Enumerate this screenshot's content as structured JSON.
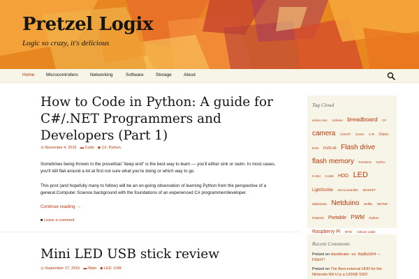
{
  "site": {
    "title": "Pretzel Logix",
    "description": "Logic so crazy, it's delicious"
  },
  "colors": {
    "accent": "#bc360a",
    "nav_bg": "#f7f5e7",
    "header_base": "#e8861f"
  },
  "nav": {
    "items": [
      {
        "label": "Home",
        "active": true
      },
      {
        "label": "Microcontrollers"
      },
      {
        "label": "Networking"
      },
      {
        "label": "Software"
      },
      {
        "label": "Storage"
      },
      {
        "label": "About"
      }
    ],
    "search_icon": "search-icon"
  },
  "posts": [
    {
      "title": "How to Code in Python: A guide for C#/.NET Programmers and Developers (Part 1)",
      "date": "November 4, 2015",
      "category": "Code",
      "tags": "C#, Python",
      "paragraphs": [
        "Sometimes being thrown in the proverbial \"deep end\" is the best way to learn — you'll either sink or swim. In most cases, you'll still flail around a lot at first not sure what you're doing or which way to go.",
        "This post (and hopefully many to follow) will be an on-going observation of learning Python from the perspective of a general Computer Science background with the foundations of an experienced C# programmer/developer."
      ],
      "continue": "Continue reading →",
      "comment": "Leave a comment"
    },
    {
      "title": "Mini LED USB stick review",
      "date": "September 17, 2015",
      "category": "Main",
      "tags": "LED, USB"
    }
  ],
  "sidebar": {
    "tag_cloud_title": "Tag Cloud",
    "tags": [
      {
        "label": "action cam",
        "size": 4.5
      },
      {
        "label": "Arduino",
        "size": 4.5
      },
      {
        "label": "breadboard",
        "size": 8.5
      },
      {
        "label": "C#",
        "size": 4.5
      },
      {
        "label": "camera",
        "size": 10
      },
      {
        "label": "CCENT",
        "size": 4.5
      },
      {
        "label": "CCNA",
        "size": 4.5
      },
      {
        "label": "C-R",
        "size": 4.5
      },
      {
        "label": "Cisco",
        "size": 5.5
      },
      {
        "label": "DVD",
        "size": 4.5
      },
      {
        "label": "DVD+R",
        "size": 5.5
      },
      {
        "label": "Flash drive",
        "size": 10
      },
      {
        "label": "flash memory",
        "size": 10
      },
      {
        "label": "FreeNAS",
        "size": 4.5
      },
      {
        "label": "GoPro",
        "size": 4.5
      },
      {
        "label": "H.264",
        "size": 4.5
      },
      {
        "label": "H.265",
        "size": 4.5
      },
      {
        "label": "HDD",
        "size": 7
      },
      {
        "label": "LED",
        "size": 11
      },
      {
        "label": "LightScribe",
        "size": 6
      },
      {
        "label": "microcontroller",
        "size": 4.5
      },
      {
        "label": "MOSFET",
        "size": 4.5
      },
      {
        "label": "Multimeter",
        "size": 4.5
      },
      {
        "label": "Netduino",
        "size": 10
      },
      {
        "label": "Netflix",
        "size": 4.5
      },
      {
        "label": "NETMF",
        "size": 4.5
      },
      {
        "label": "Polaroid",
        "size": 4.5
      },
      {
        "label": "Portable",
        "size": 7
      },
      {
        "label": "PWM",
        "size": 8
      },
      {
        "label": "Python",
        "size": 4.5
      },
      {
        "label": "Raspberry Pi",
        "size": 7
      },
      {
        "label": "RFID",
        "size": 4.5
      },
      {
        "label": "rollover cable",
        "size": 4.5
      },
      {
        "label": "SanDisk",
        "size": 7.5
      },
      {
        "label": "sd card",
        "size": 10.5
      },
      {
        "label": "SJCAM",
        "size": 4.5
      },
      {
        "label": "Smartphone",
        "size": 4.5
      },
      {
        "label": "switch",
        "size": 4.5
      },
      {
        "label": "ultra-II",
        "size": 4.5
      },
      {
        "label": "USB",
        "size": 10.5
      },
      {
        "label": "USB3",
        "size": 10
      },
      {
        "label": "Video",
        "size": 6
      },
      {
        "label": "Wii",
        "size": 5.5
      },
      {
        "label": "Wii U",
        "size": 4.5
      }
    ],
    "recent_comments_title": "Recent Comments",
    "recent_comments": [
      {
        "author": "Pretzel",
        "on": "on",
        "post": "Handbrake -vs- RipBot264 — FIGHT!"
      },
      {
        "author": "Pretzel",
        "on": "on",
        "post": "The Best external HDD for the Nintendo Wii U is a 120GB SSD!"
      }
    ]
  }
}
